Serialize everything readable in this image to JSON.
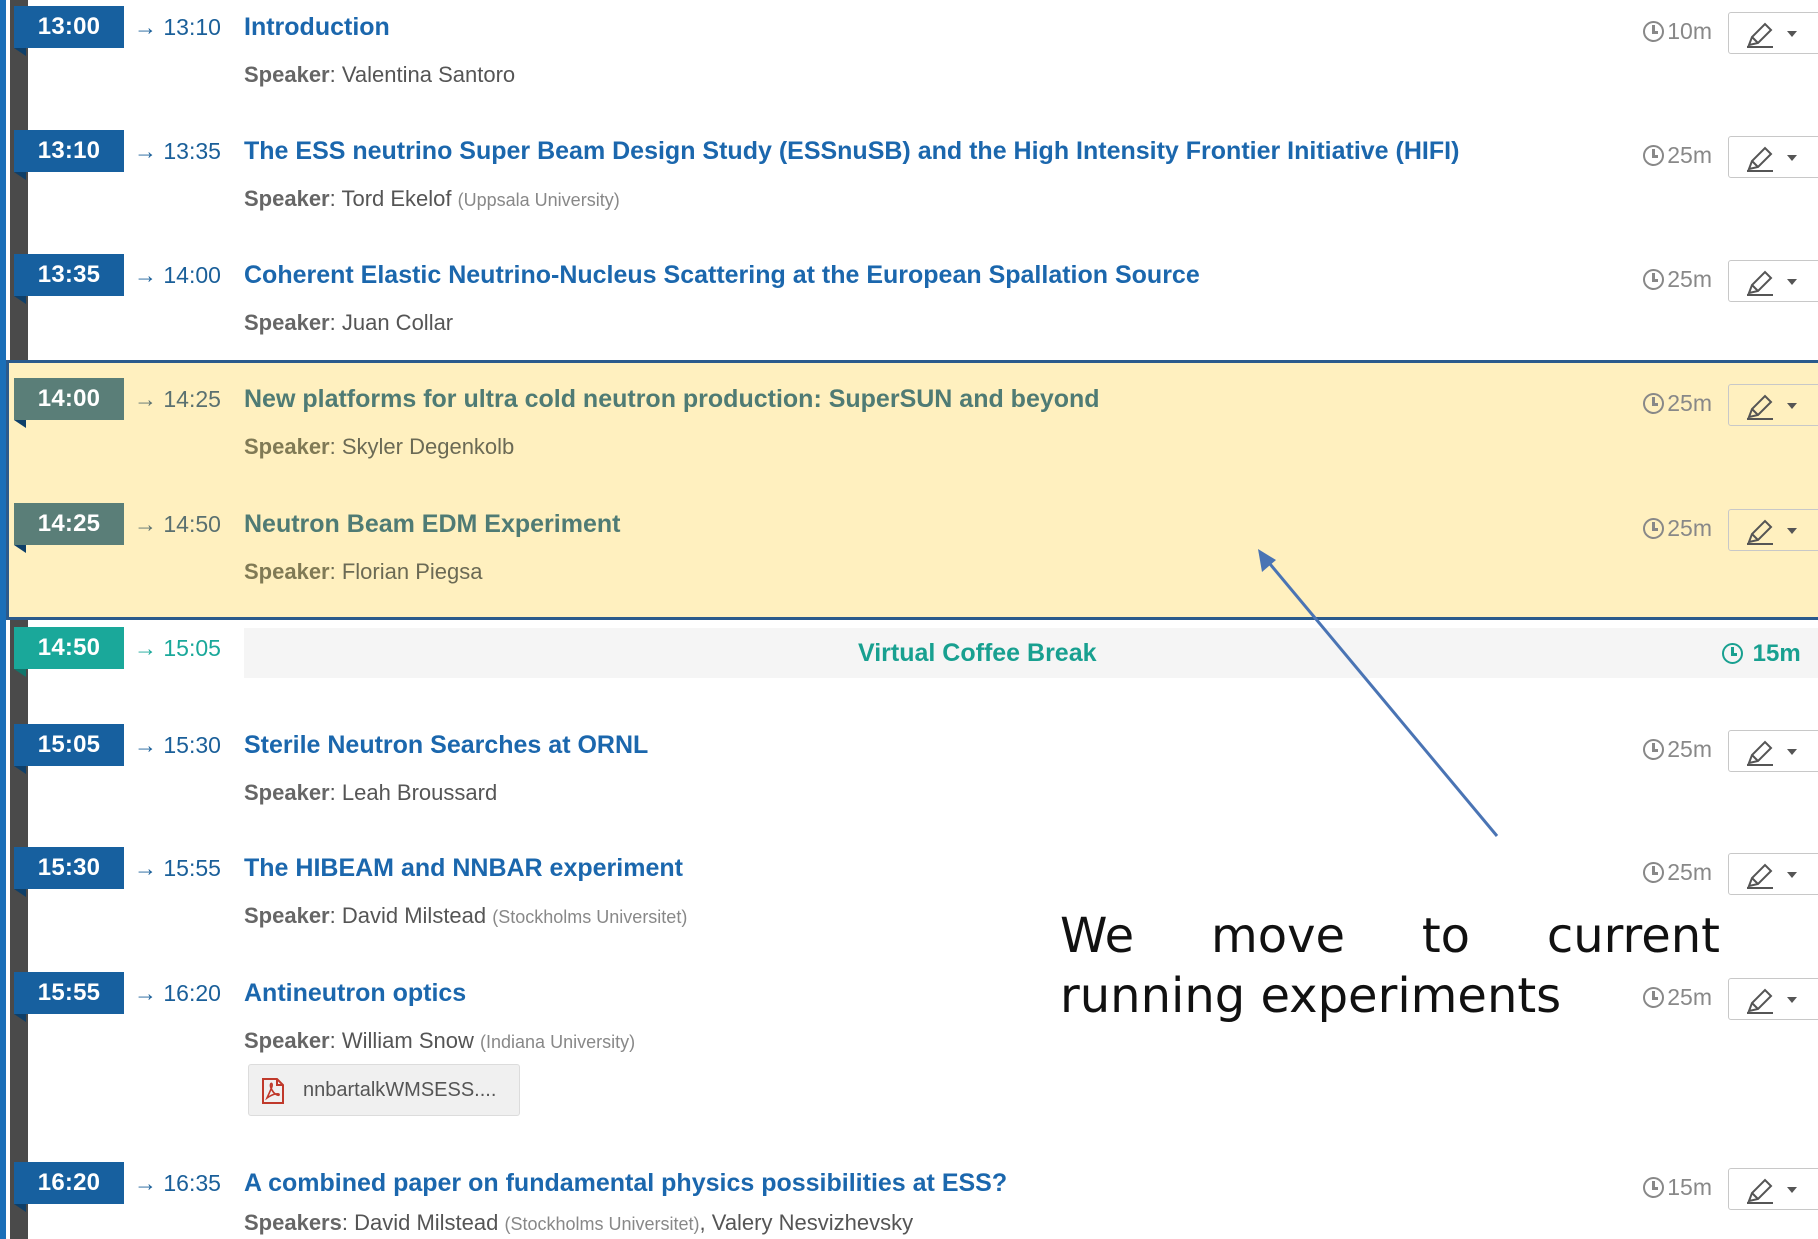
{
  "entries": [
    {
      "start": "13:00",
      "end": "→ 13:10",
      "title": "Introduction",
      "speaker_label": "Speaker",
      "speakers": "Valentina Santoro",
      "affiliation": "",
      "duration": "10m"
    },
    {
      "start": "13:10",
      "end": "→ 13:35",
      "title": "The ESS neutrino Super Beam Design Study (ESSnuSB) and the High Intensity Frontier Initiative (HIFI)",
      "speaker_label": "Speaker",
      "speakers": "Tord Ekelof",
      "affiliation": "(Uppsala University)",
      "duration": "25m"
    },
    {
      "start": "13:35",
      "end": "→ 14:00",
      "title": "Coherent Elastic Neutrino-Nucleus Scattering at the European Spallation Source",
      "speaker_label": "Speaker",
      "speakers": "Juan Collar",
      "affiliation": "",
      "duration": "25m"
    },
    {
      "start": "14:00",
      "end": "→ 14:25",
      "title": "New platforms for ultra cold neutron production: SuperSUN and beyond",
      "speaker_label": "Speaker",
      "speakers": "Skyler Degenkolb",
      "affiliation": "",
      "duration": "25m"
    },
    {
      "start": "14:25",
      "end": "→ 14:50",
      "title": "Neutron Beam EDM Experiment",
      "speaker_label": "Speaker",
      "speakers": "Florian Piegsa",
      "affiliation": "",
      "duration": "25m"
    },
    {
      "start": "15:05",
      "end": "→ 15:30",
      "title": "Sterile Neutron Searches at ORNL",
      "speaker_label": "Speaker",
      "speakers": "Leah Broussard",
      "affiliation": "",
      "duration": "25m"
    },
    {
      "start": "15:30",
      "end": "→ 15:55",
      "title": "The HIBEAM and NNBAR experiment",
      "speaker_label": "Speaker",
      "speakers": "David Milstead",
      "affiliation": "(Stockholms Universitet)",
      "duration": "25m"
    },
    {
      "start": "15:55",
      "end": "→ 16:20",
      "title": "Antineutron optics",
      "speaker_label": "Speaker",
      "speakers": "William Snow",
      "affiliation": "(Indiana University)",
      "duration": "25m"
    },
    {
      "start": "16:20",
      "end": "→ 16:35",
      "title": "A combined paper on fundamental physics possibilities at ESS?",
      "speaker_label": "Speakers",
      "speakers": "David Milstead",
      "affiliation": "(Stockholms Universitet)",
      "speaker2": ", Valery Nesvizhevsky",
      "duration": "15m"
    }
  ],
  "break": {
    "start": "14:50",
    "end": "→ 15:05",
    "title": "Virtual Coffee Break",
    "duration": "15m"
  },
  "attachment": {
    "filename": "nnbartalkWMSESS...."
  },
  "annotation": {
    "text": "We move to current running experiments"
  },
  "colors": {
    "time_box": "#17609f",
    "title": "#1b67ad",
    "highlight": "#fff0bf",
    "break_accent": "#1aa89a",
    "annotation_arrow": "#4a74b4"
  }
}
